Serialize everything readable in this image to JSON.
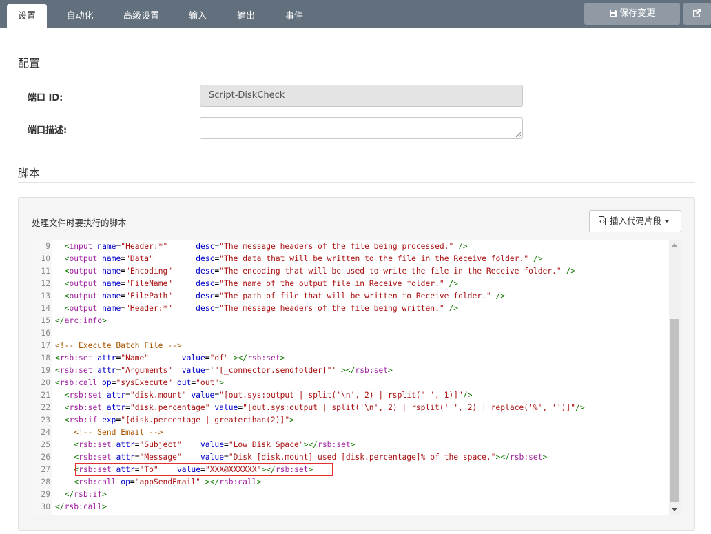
{
  "tabs": [
    {
      "label": "设置",
      "active": true
    },
    {
      "label": "自动化",
      "active": false
    },
    {
      "label": "高级设置",
      "active": false
    },
    {
      "label": "输入",
      "active": false
    },
    {
      "label": "输出",
      "active": false
    },
    {
      "label": "事件",
      "active": false
    }
  ],
  "header": {
    "save_label": "保存变更",
    "save_icon": "floppy-disk-icon",
    "external_icon": "external-link-icon"
  },
  "config": {
    "title": "配置",
    "port_id_label": "端口 ID:",
    "port_id_value": "Script-DiskCheck",
    "port_desc_label": "端口描述:",
    "port_desc_value": ""
  },
  "script": {
    "title": "脚本",
    "panel_title": "处理文件时要执行的脚本",
    "snippet_button": "插入代码片段",
    "snippet_icon": "code-file-icon",
    "highlighted_line": 27,
    "lines": [
      {
        "n": "9",
        "text": "  <input name=\"Header:*\"      desc=\"The message headers of the file being processed.\" />"
      },
      {
        "n": "10",
        "text": "  <output name=\"Data\"         desc=\"The data that will be written to the file in the Receive folder.\" />"
      },
      {
        "n": "11",
        "text": "  <output name=\"Encoding\"     desc=\"The encoding that will be used to write the file in the Receive folder.\" />"
      },
      {
        "n": "12",
        "text": "  <output name=\"FileName\"     desc=\"The name of the output file in Receive folder.\" />"
      },
      {
        "n": "13",
        "text": "  <output name=\"FilePath\"     desc=\"The path of file that will be written to Receive folder.\" />"
      },
      {
        "n": "14",
        "text": "  <output name=\"Header:*\"     desc=\"The message headers of the file being written.\" />"
      },
      {
        "n": "15",
        "text": "</arc:info>"
      },
      {
        "n": "16",
        "text": ""
      },
      {
        "n": "17",
        "text": "<!-- Execute Batch File -->"
      },
      {
        "n": "18",
        "text": "<rsb:set attr=\"Name\"       value=\"df\" ></rsb:set>"
      },
      {
        "n": "19",
        "text": "<rsb:set attr=\"Arguments\"  value='\"[_connector.sendfolder]\"' ></rsb:set>"
      },
      {
        "n": "20",
        "text": "<rsb:call op=\"sysExecute\" out=\"out\">"
      },
      {
        "n": "21",
        "text": "  <rsb:set attr=\"disk.mount\" value=\"[out.sys:output | split('\\n', 2) | rsplit(' ', 1)]\"/>"
      },
      {
        "n": "22",
        "text": "  <rsb:set attr=\"disk.percentage\" value=\"[out.sys:output | split('\\n', 2) | rsplit(' ', 2) | replace('%', '')]\"/>"
      },
      {
        "n": "23",
        "text": "  <rsb:if exp=\"[disk.percentage | greaterthan(2)]\">"
      },
      {
        "n": "24",
        "text": "    <!-- Send Email -->"
      },
      {
        "n": "25",
        "text": "    <rsb:set attr=\"Subject\"    value=\"Low Disk Space\"></rsb:set>"
      },
      {
        "n": "26",
        "text": "    <rsb:set attr=\"Message\"    value=\"Disk [disk.mount] used [disk.percentage]% of the space.\"></rsb:set>"
      },
      {
        "n": "27",
        "text": "    <rsb:set attr=\"To\"    value=\"XXX@XXXXXX\"></rsb:set>"
      },
      {
        "n": "28",
        "text": "    <rsb:call op=\"appSendEmail\" ></rsb:call>"
      },
      {
        "n": "29",
        "text": "  </rsb:if>"
      },
      {
        "n": "30",
        "text": "</rsb:call>"
      }
    ]
  },
  "colors": {
    "topbar": "#626f7c",
    "button": "#8f9aa5",
    "highlight_border": "#e03030"
  }
}
